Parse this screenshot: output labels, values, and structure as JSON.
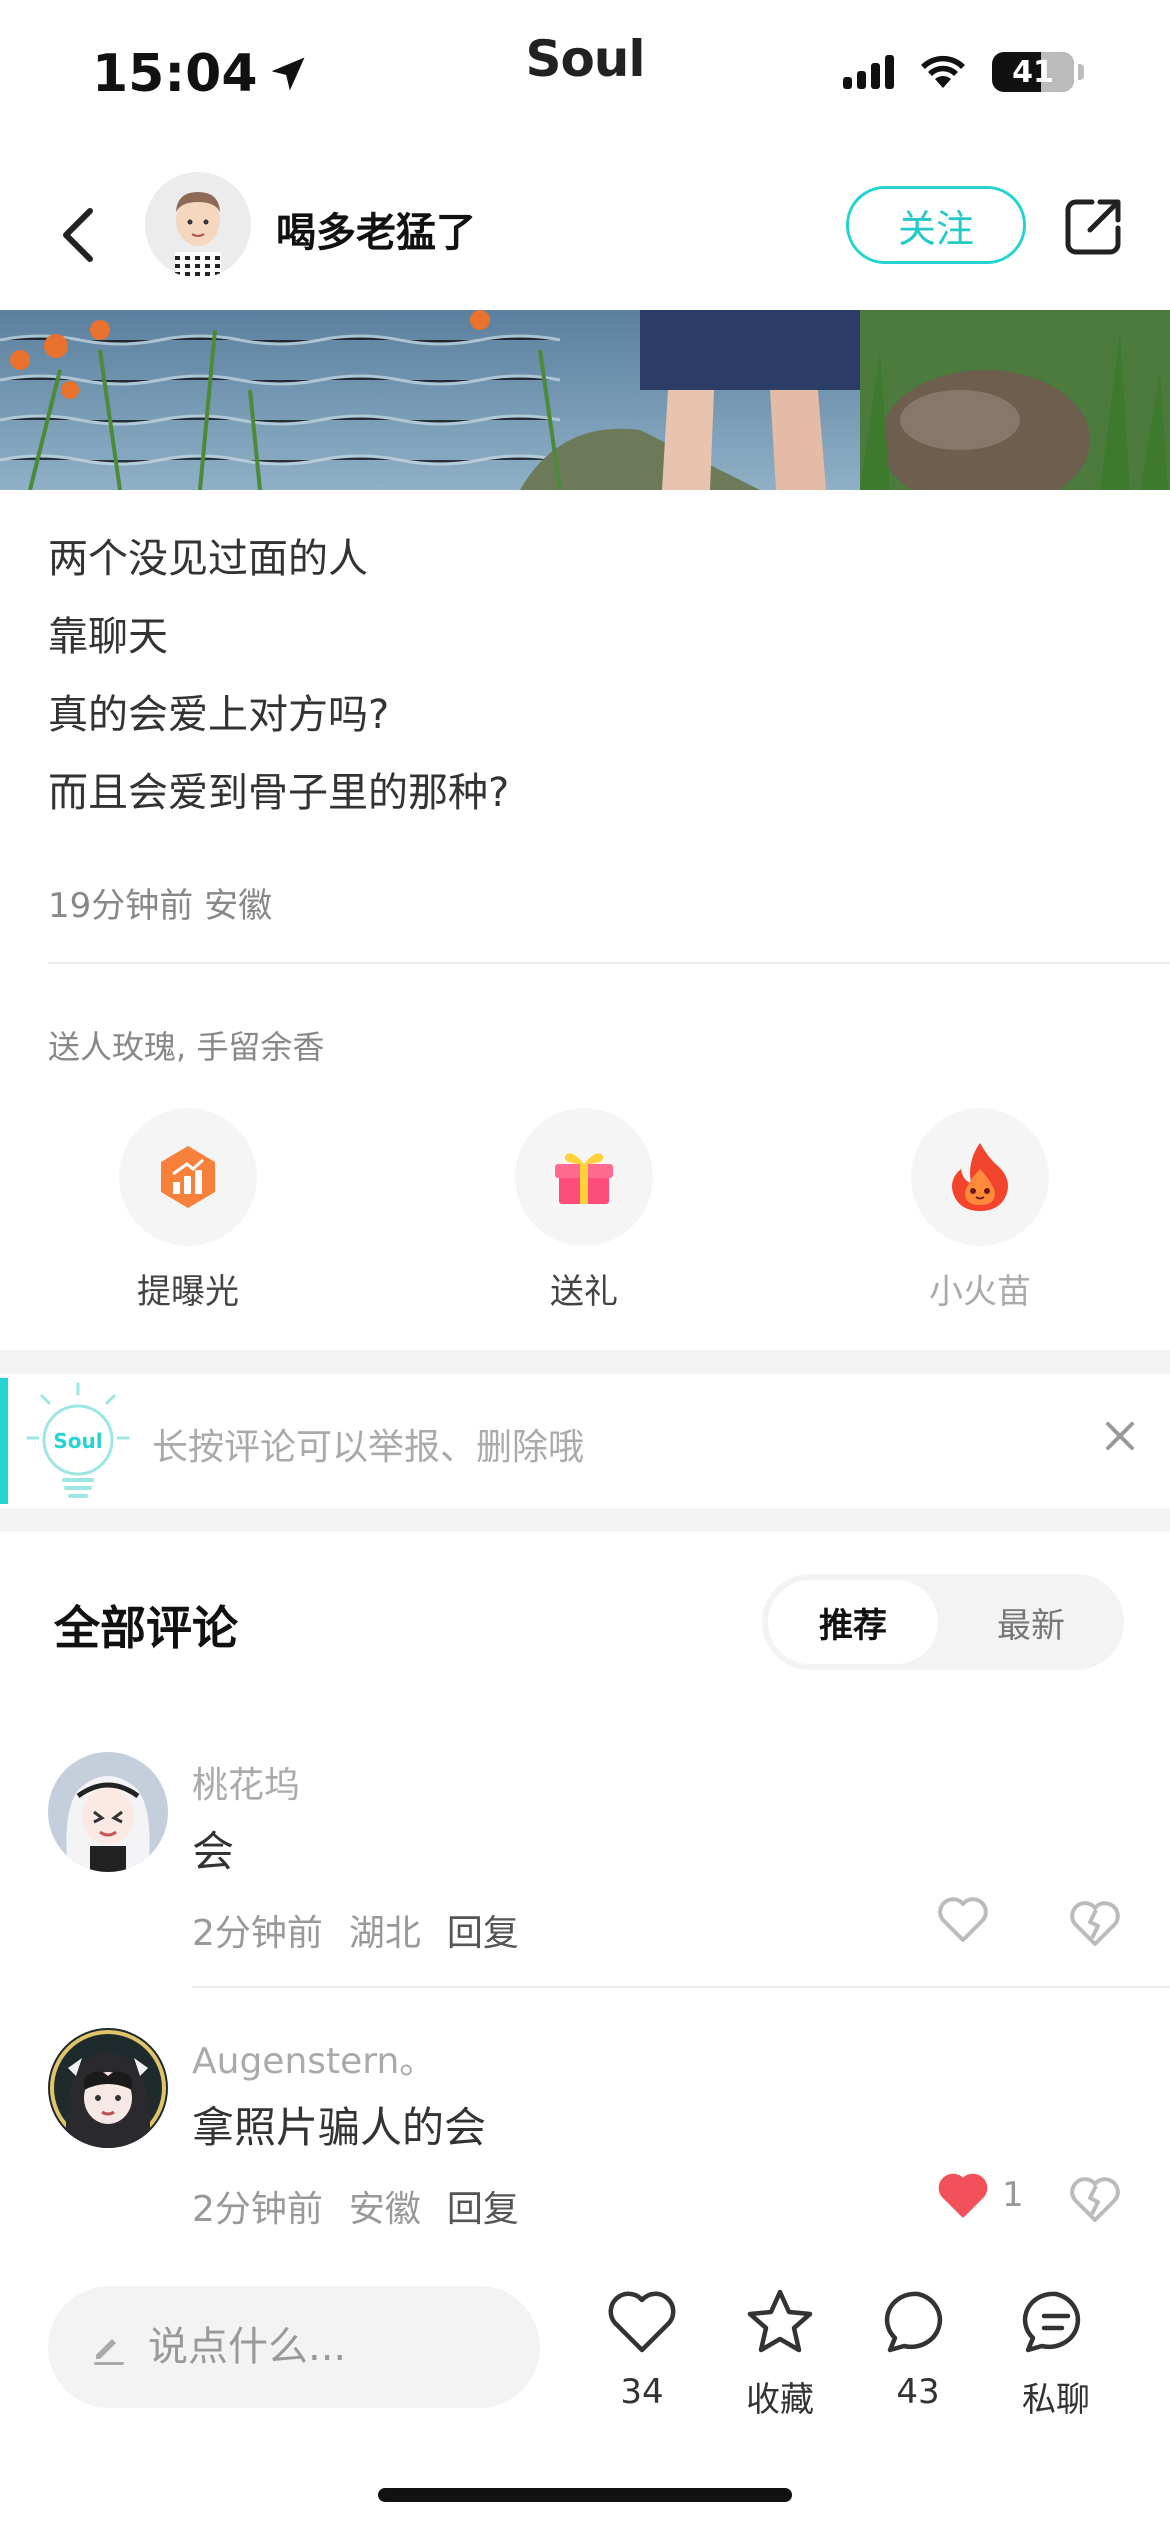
{
  "status_bar": {
    "time": "15:04",
    "app_logo": "Soul",
    "battery": "41",
    "icons": [
      "location-arrow-icon",
      "signal-icon",
      "wifi-icon",
      "battery-icon"
    ]
  },
  "header": {
    "username": "喝多老猛了",
    "follow_label": "关注",
    "icons": [
      "back-arrow-icon",
      "share-icon"
    ]
  },
  "post": {
    "lines": [
      "两个没见过面的人",
      "靠聊天",
      "真的会爱上对方吗?",
      "而且会爱到骨子里的那种?"
    ],
    "time": "19分钟前",
    "location": "安徽"
  },
  "gifts": {
    "hint": "送人玫瑰, 手留余香",
    "actions": [
      {
        "label": "提曝光",
        "icon": "boost-icon"
      },
      {
        "label": "送礼",
        "icon": "gift-icon"
      },
      {
        "label": "小火苗",
        "icon": "flame-icon"
      }
    ]
  },
  "tip": {
    "badge": "Soul",
    "text": "长按评论可以举报、删除哦"
  },
  "comments": {
    "title": "全部评论",
    "sort_options": [
      "推荐",
      "最新"
    ],
    "sort_active": "推荐",
    "items": [
      {
        "name": "桃花坞",
        "text": "会",
        "time": "2分钟前",
        "location": "湖北",
        "reply_label": "回复",
        "likes": "",
        "liked": false
      },
      {
        "name": "Augenstern。",
        "text": "拿照片骗人的会",
        "time": "2分钟前",
        "location": "安徽",
        "reply_label": "回复",
        "likes": "1",
        "liked": true
      }
    ]
  },
  "bottom_bar": {
    "input_placeholder": "说点什么...",
    "like_count": "34",
    "collect_label": "收藏",
    "comment_count": "43",
    "chat_label": "私聊"
  },
  "colors": {
    "accent": "#25d4d0",
    "liked": "#f2505a",
    "boost": "#f7803a",
    "gift": "#ff4d7a"
  }
}
